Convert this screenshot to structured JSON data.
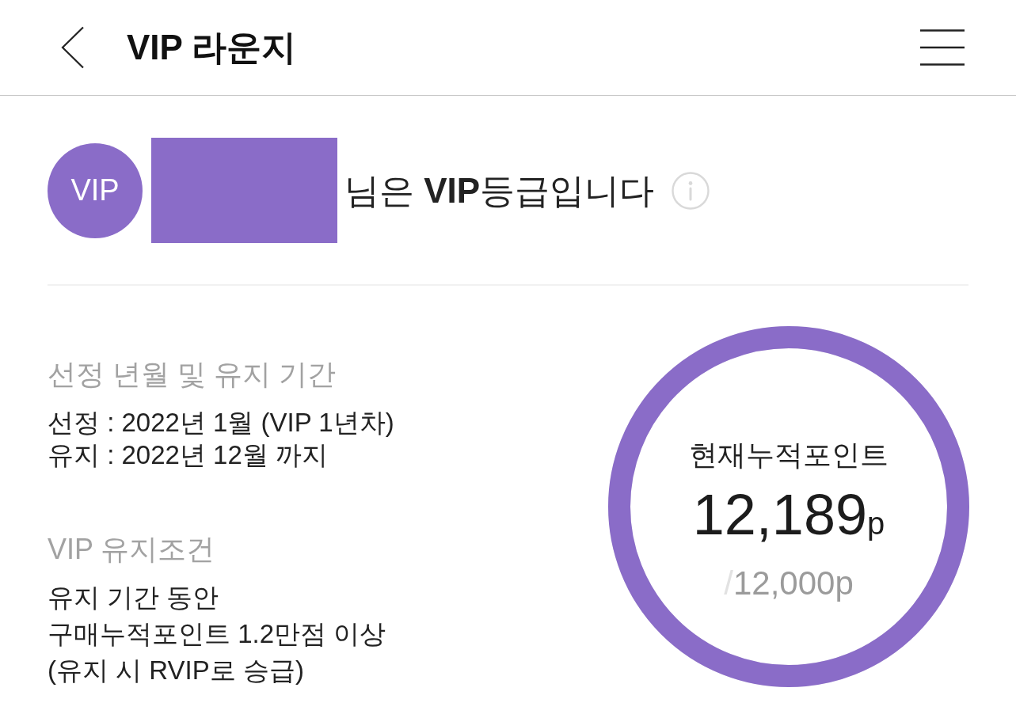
{
  "header": {
    "title": "VIP 라운지"
  },
  "profile": {
    "badge": "VIP",
    "grade_message": "님은 **VIP**등급입니다"
  },
  "selection": {
    "heading": "선정 년월 및 유지 기간",
    "lines": [
      "선정 : 2022년 1월 (VIP 1년차)",
      "유지 : 2022년 12월 까지"
    ]
  },
  "conditions": {
    "heading": "VIP 유지조건",
    "lines": [
      "유지 기간 동안",
      "구매누적포인트 1.2만점 이상",
      "(유지 시 RVIP로 승급)"
    ]
  },
  "points": {
    "label": "현재누적포인트",
    "current": "12,189",
    "current_unit": "p",
    "separator": "/",
    "target": "12,000p",
    "level": 1
  }
}
